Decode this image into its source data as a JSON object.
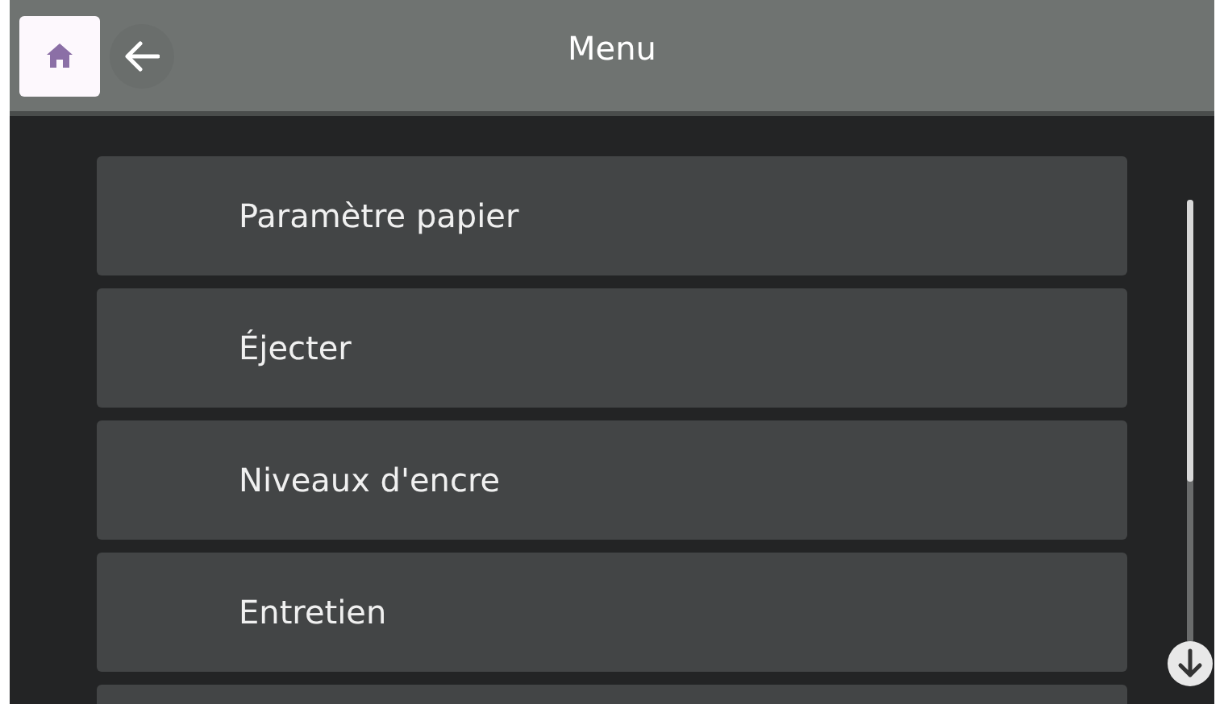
{
  "header": {
    "title": "Menu"
  },
  "menu_items": [
    {
      "label": "Paramètre papier"
    },
    {
      "label": "Éjecter"
    },
    {
      "label": "Niveaux d'encre"
    },
    {
      "label": "Entretien"
    }
  ]
}
